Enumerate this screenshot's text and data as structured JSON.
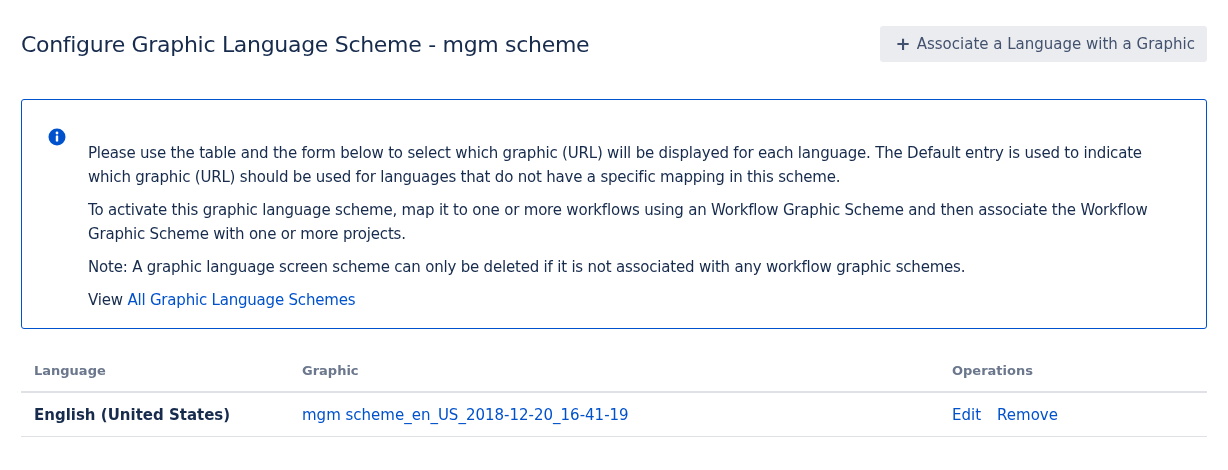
{
  "header": {
    "title": "Configure Graphic Language Scheme - mgm scheme",
    "action_button": {
      "icon": "+",
      "label": "Associate a Language with a Graphic"
    }
  },
  "info": {
    "paragraphs": [
      "Please use the table and the form below to select which graphic (URL) will be displayed for each language. The Default entry is used to indicate which graphic (URL) should be used for languages that do not have a specific mapping in this scheme.",
      "To activate this graphic language scheme, map it to one or more workflows using an Workflow Graphic Scheme and then associate the Workflow Graphic Scheme with one or more projects.",
      "Note: A graphic language screen scheme can only be deleted if it is not associated with any workflow graphic schemes."
    ],
    "view_line": {
      "text": "View",
      "link": "All Graphic Language Schemes"
    }
  },
  "table": {
    "columns": [
      "Language",
      "Graphic",
      "Operations"
    ],
    "rows": [
      {
        "language": "English (United States)",
        "graphic": "mgm scheme_en_US_2018-12-20_16-41-19",
        "operations": [
          "Edit",
          "Remove"
        ]
      }
    ]
  }
}
